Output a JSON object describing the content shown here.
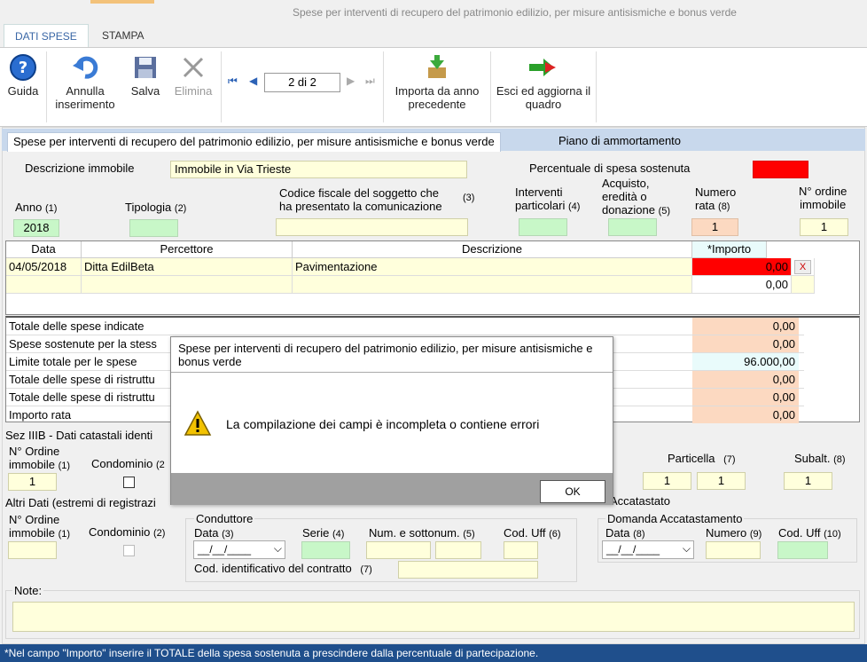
{
  "window": {
    "title": "Spese per interventi di recupero del patrimonio edilizio, per misure antisismiche e bonus verde"
  },
  "tabs": {
    "dati_spese": "DATI SPESE",
    "stampa": "STAMPA"
  },
  "toolbar": {
    "guida": "Guida",
    "annulla": "Annulla inserimento",
    "salva": "Salva",
    "elimina": "Elimina",
    "record_counter": "2 di 2",
    "importa": "Importa da anno precedente",
    "esci": "Esci ed aggiorna il quadro"
  },
  "section_tabs": {
    "main": "Spese per interventi di recupero del patrimonio edilizio, per misure antisismiche e bonus verde",
    "piano": "Piano di ammortamento"
  },
  "form": {
    "descrizione_label": "Descrizione immobile",
    "descrizione_value": "Immobile in Via Trieste",
    "percentuale_label": "Percentuale di spesa sostenuta",
    "anno_label": "Anno",
    "anno_num": "(1)",
    "anno_value": "2018",
    "tipologia_label": "Tipologia",
    "tipologia_num": "(2)",
    "codice_label_1": "Codice fiscale del soggetto che",
    "codice_label_2": "ha presentato la comunicazione",
    "codice_num": "(3)",
    "interventi_label_1": "Interventi",
    "interventi_label_2": "particolari",
    "interventi_num": "(4)",
    "acquisto_label_1": "Acquisto,",
    "acquisto_label_2": "eredità o",
    "acquisto_label_3": "donazione",
    "acquisto_num": "(5)",
    "numero_rata_label_1": "Numero",
    "numero_rata_label_2": "rata",
    "numero_rata_num": "(8)",
    "numero_rata_value": "1",
    "ordine_label_1": "N° ordine",
    "ordine_label_2": "immobile",
    "ordine_value": "1"
  },
  "grid": {
    "headers": [
      "Data",
      "Percettore",
      "Descrizione",
      "*Importo"
    ],
    "rows": [
      {
        "data": "04/05/2018",
        "percettore": "Ditta EdilBeta",
        "descrizione": "Pavimentazione",
        "importo": "0,00",
        "delete": "X"
      },
      {
        "data": "",
        "percettore": "",
        "descrizione": "",
        "importo": "0,00"
      }
    ]
  },
  "totals": [
    {
      "label": "Totale delle spese indicate",
      "value": "0,00"
    },
    {
      "label": "Spese sostenute per la stess",
      "value": "0,00"
    },
    {
      "label": "Limite totale per le spese",
      "value": "96.000,00"
    },
    {
      "label": "Totale delle spese di ristruttu",
      "value": "0,00"
    },
    {
      "label": "Totale delle spese di ristruttu",
      "value": "0,00"
    },
    {
      "label": "Importo rata",
      "value": "0,00"
    }
  ],
  "sez3b": {
    "title": "Sez IIIB - Dati catastali identi",
    "ordine_label_1": "N° Ordine",
    "ordine_label_2": "immobile",
    "ordine_num": "(1)",
    "ordine_value": "1",
    "condominio_label": "Condominio",
    "condominio_num": "(2",
    "particella_label": "Particella",
    "particella_num": "(7)",
    "particella_value_a": "1",
    "particella_value_b": "1",
    "subalt_label": "Subalt.",
    "subalt_num": "(8)",
    "subalt_value": "1",
    "accatastato": "Accatastato"
  },
  "altri": {
    "title": "Altri Dati (estremi di registrazi",
    "ordine_label_1": "N° Ordine",
    "ordine_label_2": "immobile",
    "ordine_num": "(1)",
    "condominio_label": "Condominio",
    "condominio_num": "(2)",
    "conduttore_title": "Conduttore",
    "data_label": "Data",
    "data_num": "(3)",
    "data_placeholder": "__/__/____",
    "serie_label": "Serie",
    "serie_num": "(4)",
    "num_label": "Num. e sottonum.",
    "num_num": "(5)",
    "codUff_label": "Cod. Uff",
    "codUff_num": "(6)",
    "contratto_label": "Cod. identificativo del contratto",
    "contratto_num": "(7)",
    "domanda_title": "Domanda Accatastamento",
    "domanda_data_label": "Data",
    "domanda_data_num": "(8)",
    "domanda_data_placeholder": "__/__/____",
    "numero_label": "Numero",
    "numero_num": "(9)",
    "codUff2_label": "Cod. Uff",
    "codUff2_num": "(10)"
  },
  "notes_label": "Note:",
  "footer": "*Nel campo \"Importo\" inserire il TOTALE della spesa sostenuta a prescindere dalla percentuale di partecipazione.",
  "dialog": {
    "title": "Spese per interventi di recupero del patrimonio edilizio, per misure antisismiche e bonus verde",
    "message": "La compilazione dei campi è incompleta o contiene errori",
    "ok": "OK"
  },
  "colors": {
    "accent": "#1f4f8c",
    "error": "#ff0000",
    "field": "#ffffdc",
    "field_green": "#c8f7c8",
    "field_orange": "#fcd9c1"
  },
  "icons": [
    "help-icon",
    "undo-icon",
    "save-icon",
    "delete-icon",
    "first-icon",
    "prev-icon",
    "next-icon",
    "last-icon",
    "import-icon",
    "exit-icon",
    "warning-icon"
  ]
}
